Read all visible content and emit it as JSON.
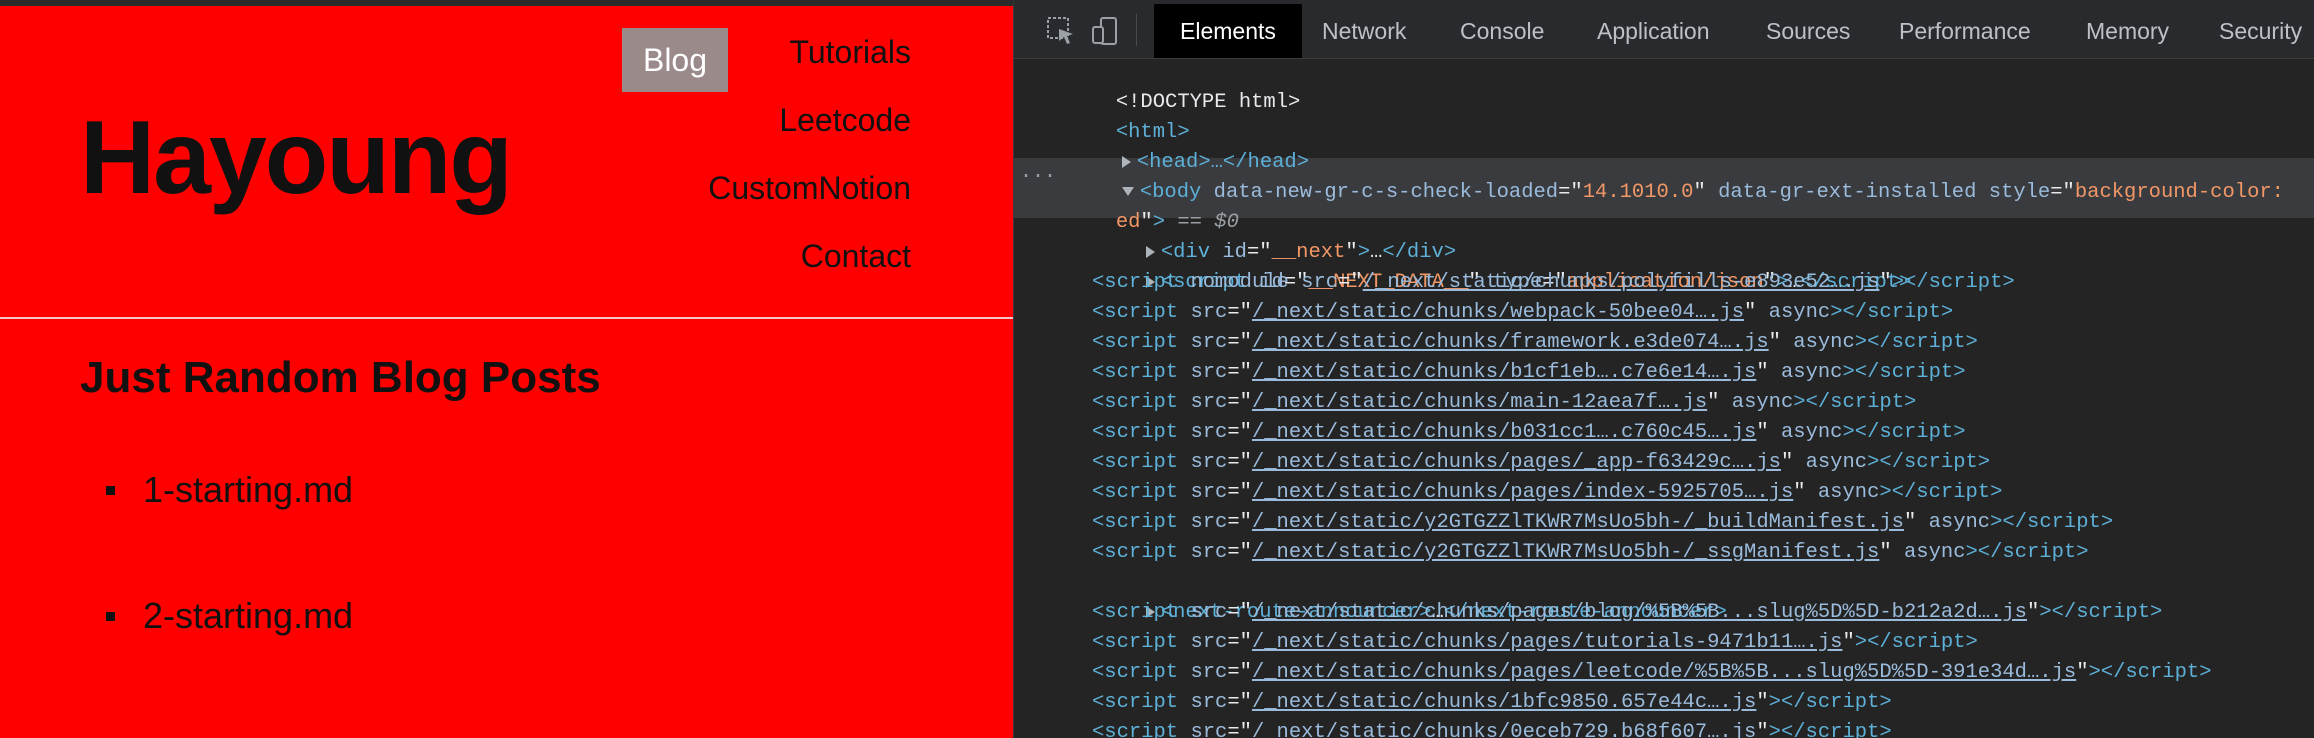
{
  "site": {
    "title": "Hayoung",
    "nav": {
      "blog": "Blog",
      "tutorials": "Tutorials",
      "leetcode": "Leetcode",
      "customnotion": "CustomNotion",
      "contact": "Contact"
    },
    "heading": "Just Random Blog Posts",
    "posts": [
      "1-starting.md",
      "2-starting.md"
    ],
    "background_color": "#ff0000"
  },
  "devtools": {
    "tabs": [
      "Elements",
      "Network",
      "Console",
      "Application",
      "Sources",
      "Performance",
      "Memory",
      "Security"
    ],
    "active_tab": "Elements",
    "icons": [
      "inspect-element-icon",
      "device-toolbar-icon"
    ],
    "dom": {
      "doctype": "<!DOCTYPE html>",
      "html_open": "<html>",
      "head": "<head>…</head>",
      "body_attr1_name": "data-new-gr-c-s-check-loaded",
      "body_attr1_value": "14.1010.0",
      "body_attr2_name": "data-gr-ext-installed",
      "body_attr3_name": "style",
      "body_attr3_value_start": "background-color:",
      "body_attr3_value_end": "ed",
      "body_suffix": "== $0",
      "next_div_id": "__next",
      "next_data_id": "__NEXT_DATA__",
      "next_data_type": "application/json",
      "route_announcer": "next-route-announcer",
      "scripts": [
        {
          "prefix": "nomodule src=",
          "src": "/_next/static/chunks/polyfills-e893e52….js",
          "suffix": ""
        },
        {
          "prefix": "src=",
          "src": "/_next/static/chunks/webpack-50bee04….js",
          "suffix": " async"
        },
        {
          "prefix": "src=",
          "src": "/_next/static/chunks/framework.e3de074….js",
          "suffix": " async"
        },
        {
          "prefix": "src=",
          "src": "/_next/static/chunks/b1cf1eb….c7e6e14….js",
          "suffix": " async"
        },
        {
          "prefix": "src=",
          "src": "/_next/static/chunks/main-12aea7f….js",
          "suffix": " async"
        },
        {
          "prefix": "src=",
          "src": "/_next/static/chunks/b031cc1….c760c45….js",
          "suffix": " async"
        },
        {
          "prefix": "src=",
          "src": "/_next/static/chunks/pages/_app-f63429c….js",
          "suffix": " async"
        },
        {
          "prefix": "src=",
          "src": "/_next/static/chunks/pages/index-5925705….js",
          "suffix": " async"
        },
        {
          "prefix": "src=",
          "src": "/_next/static/y2GTGZZlTKWR7MsUo5bh-/_buildManifest.js",
          "suffix": " async"
        },
        {
          "prefix": "src=",
          "src": "/_next/static/y2GTGZZlTKWR7MsUo5bh-/_ssgManifest.js",
          "suffix": " async"
        }
      ],
      "late_scripts": [
        "/_next/static/chunks/pages/blog/%5B%5B...slug%5D%5D-b212a2d….js",
        "/_next/static/chunks/pages/tutorials-9471b11….js",
        "/_next/static/chunks/pages/leetcode/%5B%5B...slug%5D%5D-391e34d….js",
        "/_next/static/chunks/1bfc9850.657e44c….js",
        "/_next/static/chunks/0eceb729.b68f607….js"
      ]
    }
  }
}
